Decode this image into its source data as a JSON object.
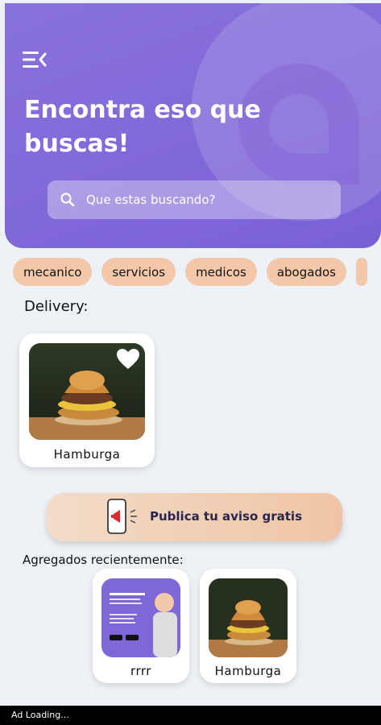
{
  "header": {
    "title": "Encontra eso que buscas!",
    "menu_icon": "menu-collapse-icon",
    "bg_color": "#7b62d7"
  },
  "search": {
    "placeholder": "Que estas buscando?",
    "icon": "search-icon"
  },
  "categories": [
    "mecanico",
    "servicios",
    "medicos",
    "abogados"
  ],
  "delivery": {
    "title": "Delivery:",
    "items": [
      {
        "label": "Hamburga",
        "favorite_icon": "heart-icon"
      }
    ]
  },
  "publish_button": {
    "label": "Publica tu aviso gratis",
    "icon": "phone-megaphone-icon"
  },
  "recent": {
    "title": "Agregados recientemente:",
    "items": [
      {
        "label": "rrrr"
      },
      {
        "label": "Hamburga"
      }
    ]
  },
  "ad_bar": {
    "text": "Ad Loading..."
  },
  "colors": {
    "accent": "#7b62d7",
    "chip": "#f2c8a9",
    "background": "#eef1f6"
  }
}
